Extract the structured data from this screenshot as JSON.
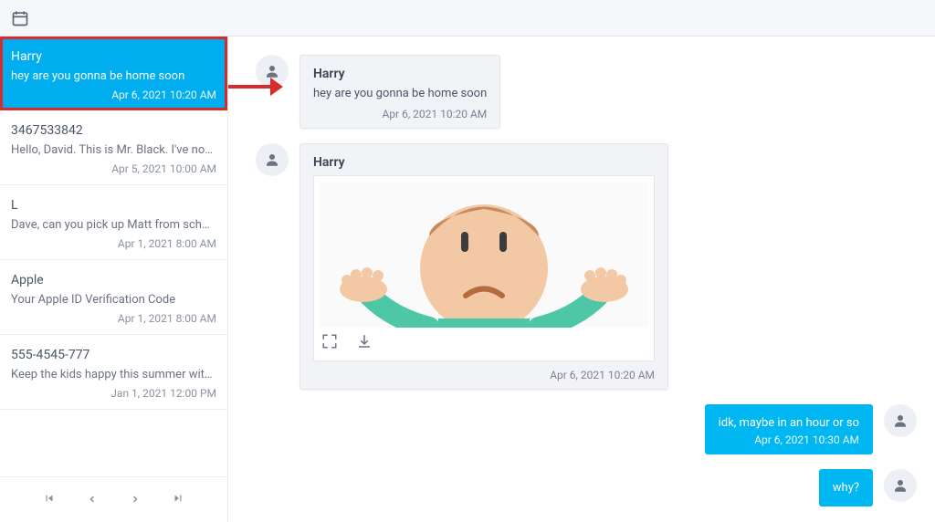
{
  "conversations": [
    {
      "name": "Harry",
      "preview": "hey are you gonna be home soon",
      "date": "Apr 6, 2021 10:20 AM",
      "selected": true
    },
    {
      "name": "3467533842",
      "preview": "Hello, David. This is Mr. Black. I've noti…",
      "date": "Apr 5, 2021 10:00 AM",
      "selected": false
    },
    {
      "name": "L",
      "preview": "Dave, can you pick up Matt from schoo…",
      "date": "Apr 1, 2021 8:00 AM",
      "selected": false
    },
    {
      "name": "Apple",
      "preview": "Your Apple ID Verification Code",
      "date": "Apr 1, 2021 8:00 AM",
      "selected": false
    },
    {
      "name": "555-4545-777",
      "preview": "Keep the kids happy this summer with …",
      "date": "Jan 1, 2021 12:00 PM",
      "selected": false
    }
  ],
  "messages": {
    "m0": {
      "sender": "Harry",
      "text": "hey are you gonna be home soon",
      "time": "Apr 6, 2021 10:20 AM"
    },
    "m1": {
      "sender": "Harry",
      "time": "Apr 6, 2021 10:20 AM"
    },
    "m2": {
      "text": "idk, maybe in an hour or so",
      "time": "Apr 6, 2021 10:30 AM"
    },
    "m3": {
      "text": "why?"
    }
  },
  "pager": {
    "first": "|<",
    "prev": "<",
    "next": ">",
    "last": ">|"
  }
}
